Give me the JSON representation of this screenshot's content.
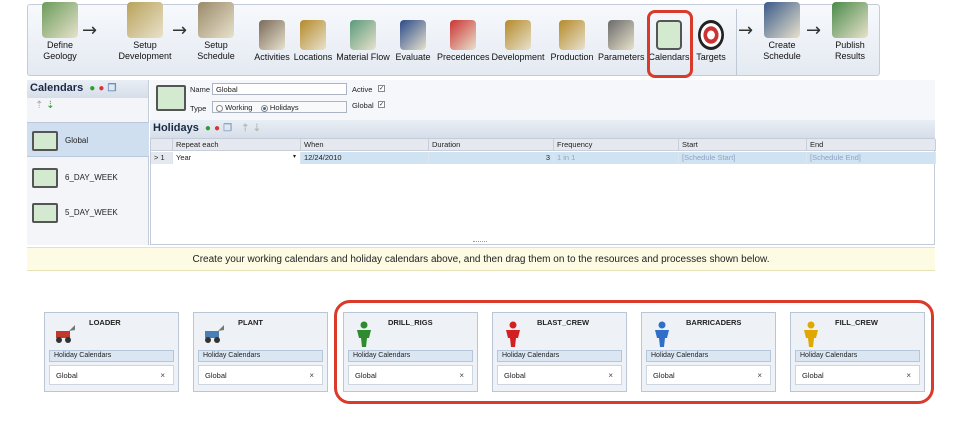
{
  "ribbon": {
    "steps": [
      {
        "label": "Define\nGeology",
        "icon": "geology-blocks-icon"
      },
      {
        "label": "Setup\nDevelopment",
        "icon": "setup-development-icon"
      },
      {
        "label": "Setup\nSchedule",
        "icon": "setup-schedule-icon"
      },
      {
        "label": "Activities",
        "icon": "activities-icon"
      },
      {
        "label": "Locations",
        "icon": "locations-icon"
      },
      {
        "label": "Material Flow",
        "icon": "material-flow-icon"
      },
      {
        "label": "Evaluate",
        "icon": "evaluate-icon"
      },
      {
        "label": "Precedences",
        "icon": "precedences-icon"
      },
      {
        "label": "Development",
        "icon": "development-icon"
      },
      {
        "label": "Production",
        "icon": "production-icon"
      },
      {
        "label": "Parameters",
        "icon": "parameters-icon"
      },
      {
        "label": "Calendars",
        "icon": "calendars-icon"
      },
      {
        "label": "Targets",
        "icon": "targets-icon"
      },
      {
        "label": "Create\nSchedule",
        "icon": "create-schedule-icon"
      },
      {
        "label": "Publish\nResults",
        "icon": "publish-results-icon"
      }
    ],
    "arrow_glyph": "→"
  },
  "calendars_panel": {
    "title": "Calendars",
    "items": [
      "Global",
      "6_DAY_WEEK",
      "5_DAY_WEEK"
    ]
  },
  "form": {
    "name_label": "Name",
    "name_value": "Global",
    "type_label": "Type",
    "type_working": "Working",
    "type_holidays": "Holidays",
    "active_label": "Active",
    "global_label": "Global",
    "check_mark": "✓"
  },
  "holidays": {
    "title": "Holidays",
    "columns": [
      "Repeat each",
      "When",
      "Duration",
      "Frequency",
      "Start",
      "End"
    ],
    "row": {
      "index": "1",
      "repeat_each": "Year",
      "when": "12/24/2010",
      "duration": "3",
      "frequency": "1 in 1",
      "start": "[Schedule Start]",
      "end": "[Schedule End]"
    }
  },
  "hint": "Create your working calendars and holiday calendars above, and then drag them on to the resources and processes shown below.",
  "resources": [
    {
      "name": "LOADER",
      "icon": "loader-icon",
      "color": "#c0392b"
    },
    {
      "name": "PLANT",
      "icon": "plant-icon",
      "color": "#4a7fb5"
    },
    {
      "name": "DRILL_RIGS",
      "icon": "person-icon",
      "color": "#2e8b2e"
    },
    {
      "name": "BLAST_CREW",
      "icon": "person-icon",
      "color": "#d32020"
    },
    {
      "name": "BARRICADERS",
      "icon": "person-icon",
      "color": "#2f6fc9"
    },
    {
      "name": "FILL_CREW",
      "icon": "person-icon",
      "color": "#e0a800"
    }
  ],
  "resource_section_label": "Holiday Calendars",
  "resource_calendar_value": "Global",
  "remove_glyph": "×",
  "colors": {
    "highlight": "#d93a2a",
    "selected_row": "#cfe3f2"
  }
}
